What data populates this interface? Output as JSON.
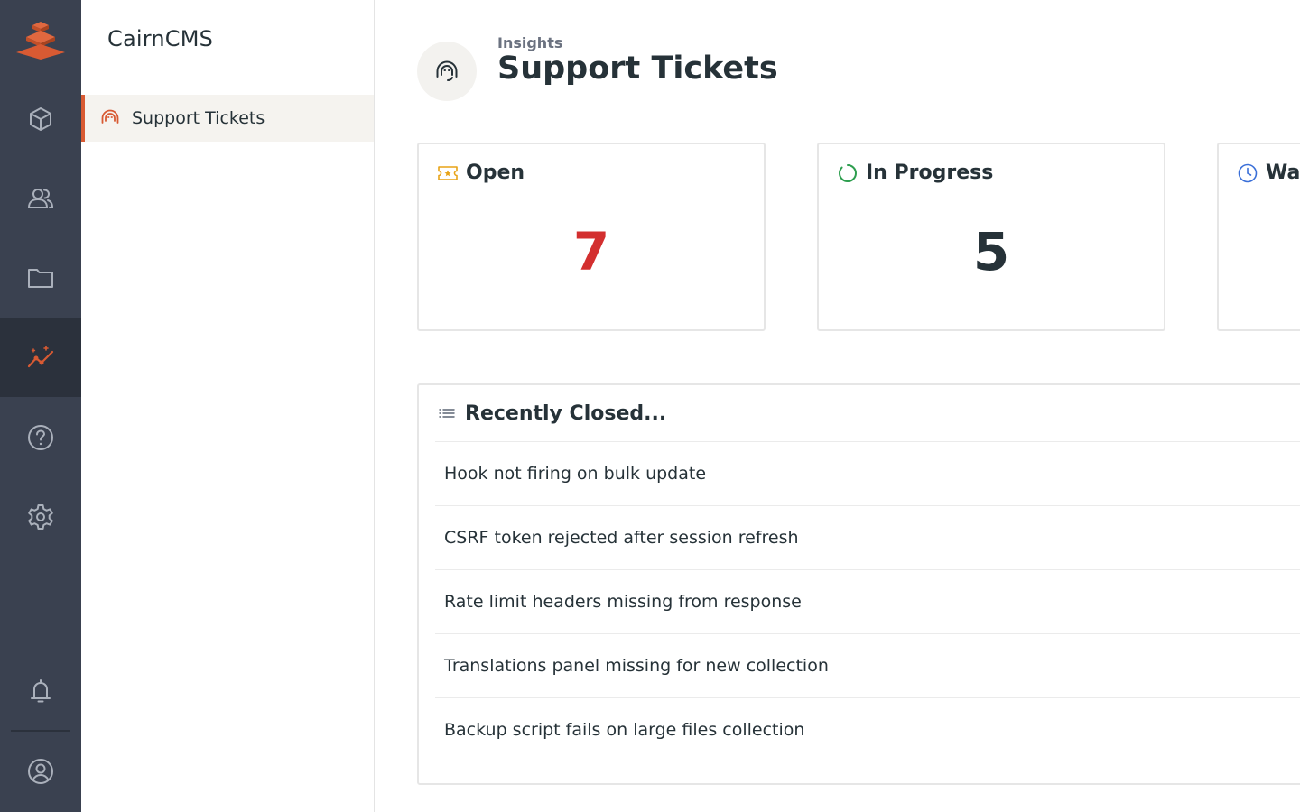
{
  "app": {
    "name": "CairnCMS",
    "brand_color": "#d85a33"
  },
  "module_bar": {
    "items": [
      {
        "icon": "box-icon",
        "name": "Content"
      },
      {
        "icon": "users-icon",
        "name": "User Directory"
      },
      {
        "icon": "folder-icon",
        "name": "File Library"
      },
      {
        "icon": "insights-icon",
        "name": "Insights",
        "active": true
      },
      {
        "icon": "help-icon",
        "name": "Documentation"
      },
      {
        "icon": "gear-icon",
        "name": "Settings"
      }
    ],
    "bottom": [
      {
        "icon": "bell-icon",
        "name": "Notifications"
      },
      {
        "icon": "user-circle-icon",
        "name": "User"
      }
    ]
  },
  "nav": {
    "items": [
      {
        "label": "Support Tickets",
        "icon": "headset-icon",
        "active": true
      }
    ]
  },
  "header": {
    "breadcrumb": "Insights",
    "title": "Support Tickets",
    "icon": "headset-icon"
  },
  "cards": [
    {
      "label": "Open",
      "icon": "ticket-icon",
      "value": "7",
      "value_color": "#d32f2f",
      "icon_color": "#e8a317"
    },
    {
      "label": "In Progress",
      "icon": "progress-icon",
      "value": "5",
      "value_color": "#263238",
      "icon_color": "#2e9e4f"
    },
    {
      "label": "Wai",
      "icon": "clock-icon",
      "value": "",
      "value_color": "#263238",
      "icon_color": "#3a6fd8"
    }
  ],
  "recent": {
    "title": "Recently Closed...",
    "icon": "list-icon",
    "items": [
      "Hook not firing on bulk update",
      "CSRF token rejected after session refresh",
      "Rate limit headers missing from response",
      "Translations panel missing for new collection",
      "Backup script fails on large files collection"
    ]
  }
}
